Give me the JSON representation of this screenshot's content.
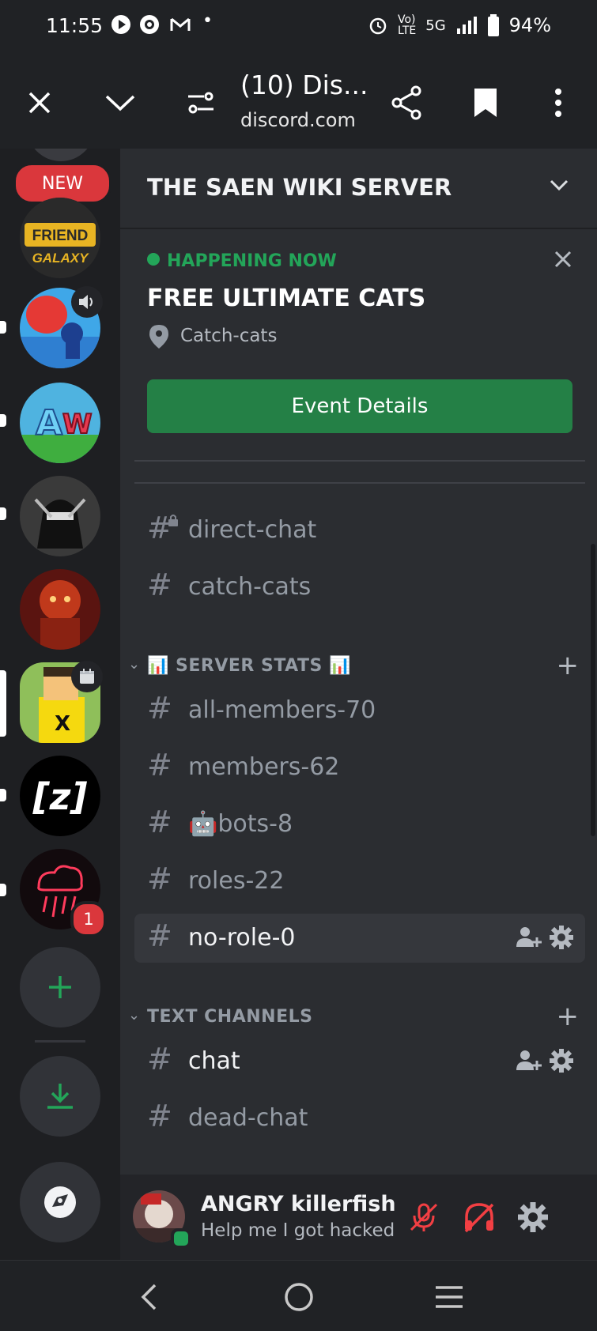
{
  "status_bar": {
    "time": "11:55",
    "battery": "94%",
    "network": "5G"
  },
  "browser": {
    "tab_title": "(10) Dis...",
    "url": "discord.com"
  },
  "rail": {
    "new_label": "NEW",
    "unread_count": "1",
    "servers": [
      {
        "name": "friend-in-the-galaxy"
      },
      {
        "name": "voice-active-server"
      },
      {
        "name": "aw-server"
      },
      {
        "name": "ninja-server"
      },
      {
        "name": "red-art-server"
      },
      {
        "name": "saen-wiki-server"
      },
      {
        "name": "z-server"
      },
      {
        "name": "rain-cloud-server"
      }
    ]
  },
  "server": {
    "name": "THE SAEN WIKI SERVER"
  },
  "event": {
    "status": "HAPPENING NOW",
    "title": "FREE ULTIMATE CATS",
    "location": "Catch-cats",
    "button_label": "Event Details"
  },
  "channels_top": [
    {
      "name": "direct-chat",
      "locked": true
    },
    {
      "name": "catch-cats"
    }
  ],
  "categories": {
    "server_stats": {
      "label": "📊 SERVER STATS 📊"
    },
    "text_channels": {
      "label": "TEXT CHANNELS"
    }
  },
  "server_stats_channels": [
    {
      "name": "all-members-70"
    },
    {
      "name": "members-62"
    },
    {
      "name": "🤖bots-8"
    },
    {
      "name": "roles-22"
    },
    {
      "name": "no-role-0"
    }
  ],
  "text_channels": [
    {
      "name": "chat"
    },
    {
      "name": "dead-chat"
    }
  ],
  "user": {
    "name": "ANGRY killerfish",
    "status": "Help me I got hacked"
  },
  "colors": {
    "accent_green": "#23a559",
    "button_green": "#248046",
    "danger_red": "#da373c",
    "panel_bg": "#2b2d31"
  }
}
